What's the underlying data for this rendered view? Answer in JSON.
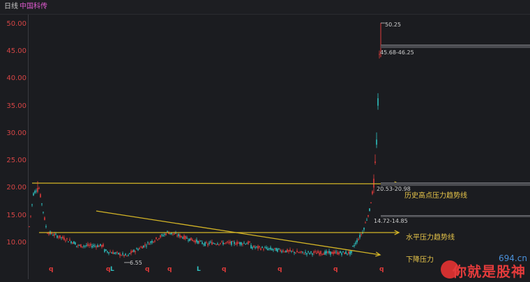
{
  "header": {
    "period_label": "日线",
    "stock_name": "中国科传"
  },
  "axis": {
    "ticks": [
      "50.00",
      "45.00",
      "40.00",
      "35.00",
      "30.00",
      "25.00",
      "20.00",
      "15.00",
      "10.00"
    ]
  },
  "annotations": {
    "peak_price": "50.25",
    "low_price": "6.55",
    "zone_high": "45.68-46.25",
    "zone_mid": "20.53-20.98",
    "zone_low": "14.72-14.85"
  },
  "trendlines": {
    "historic_high": "历史高点压力趋势线",
    "horizontal": "水平压力趋势线",
    "descending": "下降压力"
  },
  "markers": [
    {
      "text": "q",
      "color": "#e23b3b"
    },
    {
      "text": "q",
      "color": "#e23b3b"
    },
    {
      "text": "L",
      "color": "#2fc1c1"
    },
    {
      "text": "q",
      "color": "#e23b3b"
    },
    {
      "text": "q",
      "color": "#e23b3b"
    },
    {
      "text": "L",
      "color": "#2fc1c1"
    },
    {
      "text": "q",
      "color": "#e23b3b"
    },
    {
      "text": "q",
      "color": "#e23b3b"
    },
    {
      "text": "q",
      "color": "#e23b3b"
    },
    {
      "text": "q",
      "color": "#e23b3b"
    }
  ],
  "watermark": {
    "url": "694.cn",
    "text": "你就是股神"
  },
  "colors": {
    "up": "#e23b3b",
    "down": "#2fc1c1",
    "trendline": "#d4b526",
    "price_axis": "#d64545"
  }
}
